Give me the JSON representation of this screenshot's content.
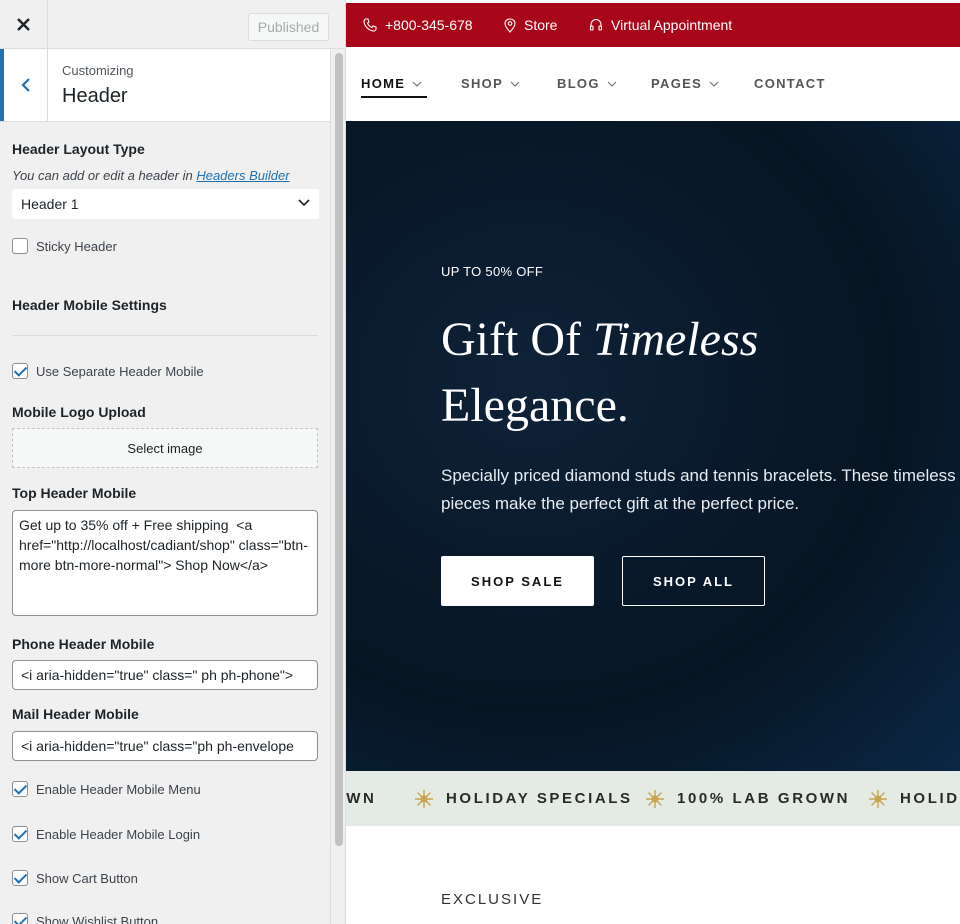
{
  "sidebar": {
    "published_label": "Published",
    "breadcrumb": "Customizing",
    "section_title": "Header",
    "layout_type": {
      "label": "Header Layout Type",
      "desc_prefix": "You can add or edit a header in",
      "desc_link": "Headers Builder",
      "selected": "Header 1"
    },
    "sticky_header": {
      "label": "Sticky Header",
      "checked": false
    },
    "mobile_settings_heading": "Header Mobile Settings",
    "separate_mobile": {
      "label": "Use Separate Header Mobile",
      "checked": true
    },
    "mobile_logo": {
      "label": "Mobile Logo Upload",
      "button": "Select image"
    },
    "top_header_mobile": {
      "label": "Top Header Mobile",
      "value": "Get up to 35% off + Free shipping  <a href=\"http://localhost/cadiant/shop\" class=\"btn-more btn-more-normal\"> Shop Now</a>"
    },
    "phone_header_mobile": {
      "label": "Phone Header Mobile",
      "value": "<i aria-hidden=\"true\" class=\" ph ph-phone\">"
    },
    "mail_header_mobile": {
      "label": "Mail Header Mobile",
      "value": "<i aria-hidden=\"true\" class=\"ph ph-envelope"
    },
    "checks": [
      {
        "label": "Enable Header Mobile Menu",
        "checked": true
      },
      {
        "label": "Enable Header Mobile Login",
        "checked": true
      },
      {
        "label": "Show Cart Button",
        "checked": true
      },
      {
        "label": "Show Wishlist Button",
        "checked": true
      }
    ]
  },
  "preview": {
    "topbar": {
      "phone": "+800-345-678",
      "store": "Store",
      "appointment": "Virtual Appointment"
    },
    "nav": [
      "HOME",
      "SHOP",
      "BLOG",
      "PAGES",
      "CONTACT"
    ],
    "hero": {
      "eyebrow": "UP TO 50% OFF",
      "title_line1_plain": "Gift Of ",
      "title_line1_italic": "Timeless",
      "title_line2": "Elegance.",
      "text": "Specially priced diamond studs and tennis bracelets. These timeless pieces make the perfect gift at the perfect price.",
      "btn_primary": "SHOP SALE",
      "btn_secondary": "SHOP ALL"
    },
    "marquee": [
      "OWN",
      "HOLIDAY SPECIALS",
      "100% LAB GROWN",
      "HOLIDA"
    ],
    "section_eyebrow": "EXCLUSIVE"
  },
  "colors": {
    "topbar": "#a8071a",
    "accent": "#2271b1",
    "marquee_bg": "#e4ebe4",
    "star": "#c9a44c"
  }
}
